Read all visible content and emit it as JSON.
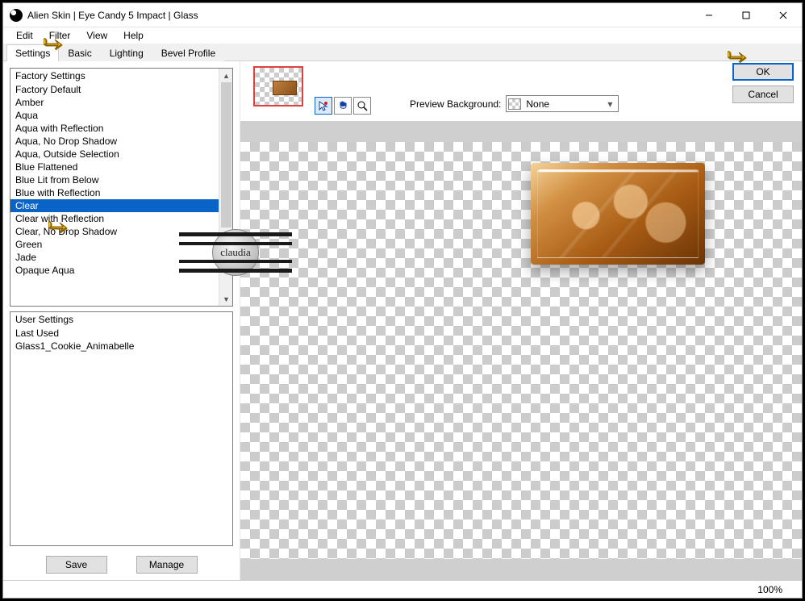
{
  "titlebar": {
    "title": "Alien Skin | Eye Candy 5 Impact | Glass"
  },
  "menu": {
    "edit": "Edit",
    "filter": "Filter",
    "view": "View",
    "help": "Help"
  },
  "tabs": {
    "settings": "Settings",
    "basic": "Basic",
    "lighting": "Lighting",
    "bevel": "Bevel Profile",
    "active": "settings"
  },
  "factory": {
    "header": "Factory Settings",
    "items": [
      "Factory Default",
      "Amber",
      "Aqua",
      "Aqua with Reflection",
      "Aqua, No Drop Shadow",
      "Aqua, Outside Selection",
      "Blue Flattened",
      "Blue Lit from Below",
      "Blue with Reflection",
      "Clear",
      "Clear with Reflection",
      "Clear, No Drop Shadow",
      "Green",
      "Jade",
      "Opaque Aqua"
    ],
    "selected": "Clear"
  },
  "user": {
    "header": "User Settings",
    "items": [
      "Last Used",
      "Glass1_Cookie_Animabelle"
    ]
  },
  "buttons": {
    "save": "Save",
    "manage": "Manage",
    "ok": "OK",
    "cancel": "Cancel"
  },
  "preview": {
    "label": "Preview Background:",
    "value": "None"
  },
  "status": {
    "zoom": "100%"
  },
  "watermark": {
    "text": "claudia"
  }
}
